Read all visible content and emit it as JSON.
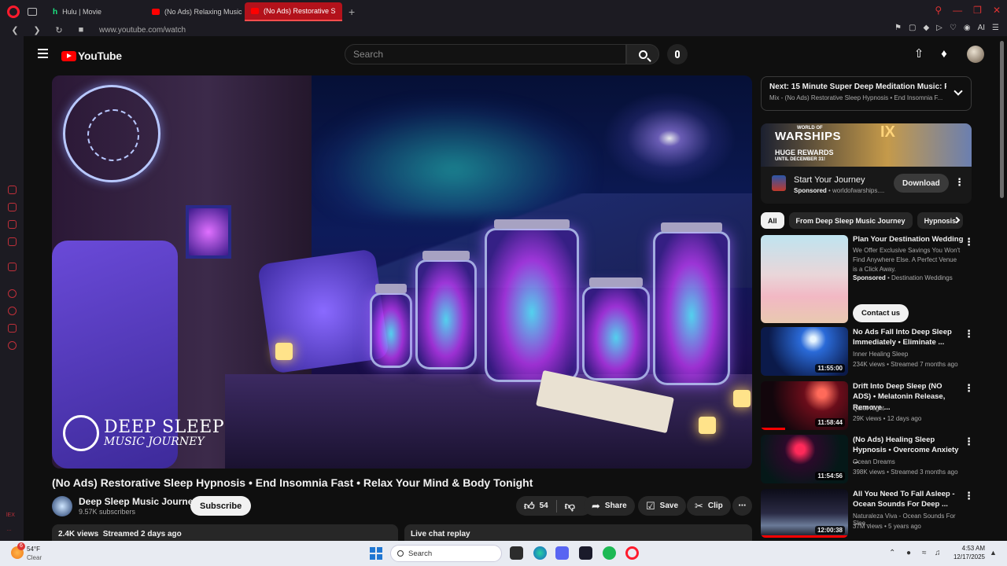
{
  "browser": {
    "tabs": [
      {
        "label": "Hulu | Movie",
        "favicon": "hulu-icon"
      },
      {
        "label": "(No Ads) Relaxing Music",
        "favicon": "youtube-icon"
      },
      {
        "label": "(No Ads) Restorative S",
        "favicon": "speaker-icon",
        "active": true
      }
    ],
    "url": "www.youtube.com/watch",
    "ai_label": "AI",
    "sidebar_badge": "lEX"
  },
  "youtube": {
    "logo_text": "YouTube",
    "search_placeholder": "Search"
  },
  "video": {
    "title": "(No Ads) Restorative Sleep Hypnosis • End Insomnia Fast • Relax Your Mind & Body Tonight",
    "watermark_line1": "DEEP SLEEP",
    "watermark_line2": "MUSIC JOURNEY",
    "channel_name": "Deep Sleep Music Journey",
    "subscribers": "9.57K subscribers",
    "subscribe_label": "Subscribe",
    "likes": "54",
    "share_label": "Share",
    "save_label": "Save",
    "clip_label": "Clip",
    "views_line": "2.4K views  Streamed 2 days ago",
    "live_chat_label": "Live chat replay"
  },
  "up_next": {
    "title": "Next: 15 Minute Super Deep Meditation Music: Rela...",
    "subtitle": "Mix - (No Ads) Restorative Sleep Hypnosis • End Insomnia F..."
  },
  "ad": {
    "brand": "WARSHIPS",
    "brand_small": "WORLD OF",
    "promo_line1": "HUGE REWARDS",
    "promo_line2": "UNTIL DECEMBER 31!",
    "roman": "IX",
    "title": "Start Your Journey",
    "sponsored": "Sponsored",
    "sponsor_domain": " • worldofwarships....",
    "cta": "Download"
  },
  "chips": [
    "All",
    "From Deep Sleep Music Journey",
    "Hypnosis"
  ],
  "sponsored_rec": {
    "title": "Plan Your Destination Wedding",
    "description": "We Offer Exclusive Savings You Won't Find Anywhere Else. A Perfect Venue is a Click Away.",
    "sponsored": "Sponsored",
    "advertiser": " • Destination Weddings",
    "cta": "Contact us"
  },
  "recommendations": [
    {
      "title": "No Ads Fall Into Deep Sleep Immediately • Eliminate ...",
      "channel": "Inner Healing Sleep",
      "meta": "234K views • Streamed 7 months ago",
      "duration": "11:55:00",
      "progress": 0
    },
    {
      "title": "Drift Into Deep Sleep (NO ADS) • Melatonin Release, Remove ...",
      "channel": "Quiet Night",
      "meta": "29K views • 12 days ago",
      "duration": "11:58:44",
      "progress": 0.28
    },
    {
      "title": "(No Ads) Healing Sleep Hypnosis • Overcome Anxiety ...",
      "channel": "Ocean Dreams",
      "meta": "398K views • Streamed 3 months ago",
      "duration": "11:54:56",
      "progress": 0
    },
    {
      "title": "All You Need To Fall Asleep - Ocean Sounds For Deep ...",
      "channel": "Naturaleza Viva - Ocean Sounds For Slee...",
      "meta": "37M views • 5 years ago",
      "duration": "12:00:38",
      "progress": 1
    }
  ],
  "taskbar": {
    "weather_badge": "6",
    "temperature": "54°F",
    "condition": "Clear",
    "search_label": "Search",
    "time": "4:53 AM",
    "date": "12/17/2025"
  },
  "colors": {
    "youtube_red": "#ff0000",
    "opera_red": "#ff1b2d",
    "background": "#0f0f0f"
  }
}
